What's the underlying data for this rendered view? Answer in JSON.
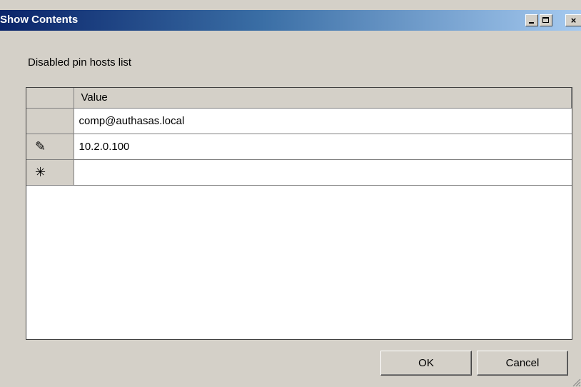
{
  "window": {
    "title": "Show Contents",
    "controls": {
      "minimize": "minimize",
      "maximize": "maximize",
      "close": "×"
    }
  },
  "prompt": "Disabled pin hosts list",
  "grid": {
    "column_header": "Value",
    "rows": [
      {
        "indicator": "",
        "value": "comp@authasas.local"
      },
      {
        "indicator": "✎",
        "value": "10.2.0.100"
      },
      {
        "indicator": "✳",
        "value": ""
      }
    ]
  },
  "buttons": {
    "ok": "OK",
    "cancel": "Cancel"
  },
  "colors": {
    "face": "#d4d0c8",
    "title_gradient_start": "#0a246a",
    "title_gradient_end": "#a6caf0",
    "title_text": "#ffffff"
  }
}
